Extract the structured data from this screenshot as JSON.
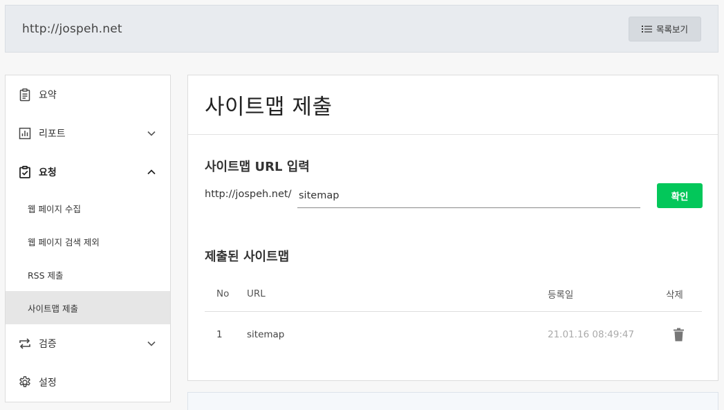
{
  "header": {
    "site_url": "http://jospeh.net",
    "list_button_label": "목록보기"
  },
  "sidebar": {
    "items": [
      {
        "label": "요약",
        "icon": "clipboard-icon"
      },
      {
        "label": "리포트",
        "icon": "bar-chart-icon"
      },
      {
        "label": "요청",
        "icon": "clipboard-check-icon"
      },
      {
        "label": "검증",
        "icon": "repeat-icon"
      },
      {
        "label": "설정",
        "icon": "gear-icon"
      }
    ],
    "sub_items": [
      {
        "label": "웹 페이지 수집"
      },
      {
        "label": "웹 페이지 검색 제외"
      },
      {
        "label": "RSS 제출"
      },
      {
        "label": "사이트맵 제출"
      }
    ]
  },
  "main": {
    "title": "사이트맵 제출",
    "input_section_title": "사이트맵 URL 입력",
    "url_prefix": "http://jospeh.net/",
    "url_value": "sitemap",
    "confirm_label": "확인",
    "list_section_title": "제출된 사이트맵",
    "table": {
      "headers": {
        "no": "No",
        "url": "URL",
        "date": "등록일",
        "delete": "삭제"
      },
      "rows": [
        {
          "no": "1",
          "url": "sitemap",
          "date": "21.01.16 08:49:47"
        }
      ]
    }
  },
  "colors": {
    "accent_green": "#03c75a",
    "header_bg": "#e8ebef",
    "active_bg": "#e6e6e6"
  }
}
